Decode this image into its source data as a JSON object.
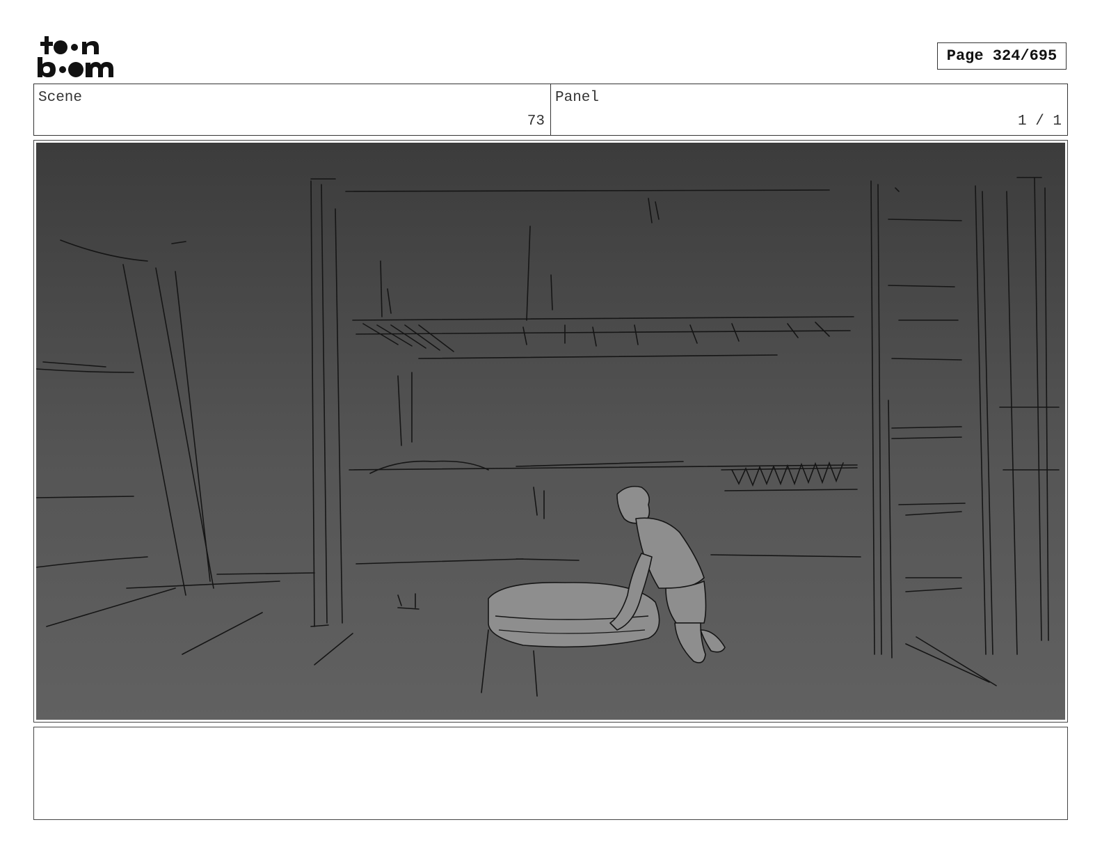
{
  "header": {
    "logo": {
      "name": "toon-boom-logo",
      "lettering": "toon boom"
    },
    "page_indicator": "Page 324/695"
  },
  "info": {
    "scene": {
      "label": "Scene",
      "value": "73"
    },
    "panel": {
      "label": "Panel",
      "value": "1 / 1"
    }
  },
  "storyboard_panel": {
    "image": "pencil sketch of a boy kneeling beside a round cushion in a barn interior",
    "palette": {
      "sky_top": "#3b3b3b",
      "ground": "#5f5f5f",
      "figure_fill": "#8e8e8e",
      "line": "#141414"
    }
  },
  "notes": {
    "text": ""
  }
}
